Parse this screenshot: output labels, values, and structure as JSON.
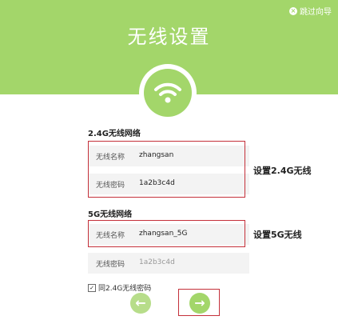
{
  "header": {
    "title": "无线设置",
    "skip_label": "跳过向导",
    "skip_icon": "close-icon"
  },
  "wifi_icon": "wifi-icon",
  "band24": {
    "section_label": "2.4G无线网络",
    "name_label": "无线名称",
    "name_value": "zhangsan",
    "password_label": "无线密码",
    "password_value": "1a2b3c4d",
    "annotation": "设置2.4G无线"
  },
  "band5": {
    "section_label": "5G无线网络",
    "name_label": "无线名称",
    "name_value": "zhangsan_5G",
    "password_label": "无线密码",
    "password_value": "1a2b3c4d",
    "annotation": "设置5G无线"
  },
  "same_password": {
    "label": "同2.4G无线密码",
    "checked": true
  },
  "nav": {
    "back_icon": "arrow-left-icon",
    "next_icon": "arrow-right-icon"
  },
  "colors": {
    "accent": "#a3d66a",
    "highlight_border": "#c4303a"
  }
}
